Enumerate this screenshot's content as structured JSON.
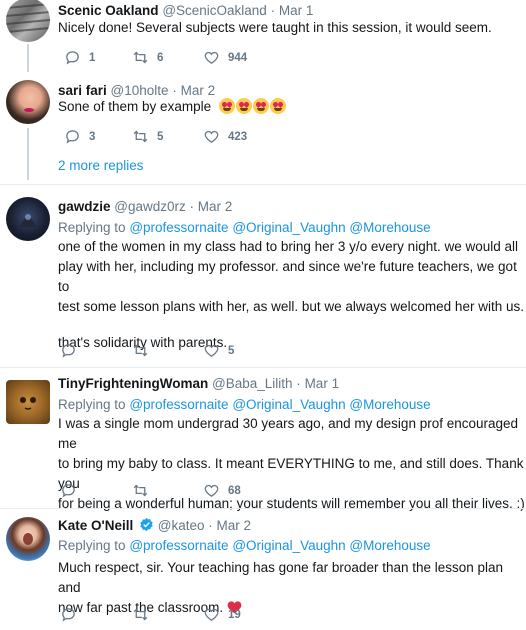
{
  "tweets": [
    {
      "name": "Scenic Oakland",
      "handle": "@ScenicOakland",
      "dot": "·",
      "time": "Mar 1",
      "text": "Nicely done!  Several subjects were taught in this session, it would seem.",
      "reply_count": "1",
      "retweet_count": "6",
      "like_count": "944"
    },
    {
      "name": "sari fari",
      "handle": "@10holte",
      "dot": "·",
      "time": "Mar 2",
      "text": "Sone of them by example",
      "emoji": "heart-eyes-emoji x4",
      "reply_count": "3",
      "retweet_count": "5",
      "like_count": "423"
    },
    {
      "name": "gawdzie",
      "handle": "@gawdz0rz",
      "dot": "·",
      "time": "Mar 2",
      "replying_label": "Replying to",
      "mentions": [
        "@professornaite",
        "@Original_Vaughn",
        "@Morehouse"
      ],
      "text_lines": [
        "one of the women in my class had to bring her 3 y/o every night. we would all",
        "play with her, including my professor. and since we're future teachers, we got to",
        "test some lesson plans with her, as well. but we always welcomed her with us.",
        "",
        "that's solidarity with parents."
      ],
      "reply_count": "",
      "retweet_count": "",
      "like_count": "5"
    },
    {
      "name": "TinyFrighteningWoman",
      "handle": "@Baba_Lilith",
      "dot": "·",
      "time": "Mar 1",
      "replying_label": "Replying to",
      "mentions": [
        "@professornaite",
        "@Original_Vaughn",
        "@Morehouse"
      ],
      "text_lines": [
        "I was a single mom undergrad 30 years ago, and my design prof encouraged me",
        "to bring my baby to class. It meant EVERYTHING to me, and still does. Thank you",
        "for being a wonderful human; your students will remember you all their lives. :)"
      ],
      "reply_count": "",
      "retweet_count": "",
      "like_count": "68"
    },
    {
      "name": "Kate O'Neill",
      "handle": "@kateo",
      "dot": "·",
      "time": "Mar 2",
      "replying_label": "Replying to",
      "mentions": [
        "@professornaite",
        "@Original_Vaughn",
        "@Morehouse"
      ],
      "text_lines": [
        "Much respect, sir. Your teaching has gone far broader than the lesson plan and",
        "now far past the classroom."
      ],
      "reply_count": "",
      "retweet_count": "",
      "like_count": "19"
    }
  ],
  "more_replies": "2 more replies",
  "colors": {
    "link": "#1b95e0",
    "muted": "#657786",
    "text": "#14171a",
    "border": "#e6ecf0",
    "heart": "#e0245e"
  }
}
